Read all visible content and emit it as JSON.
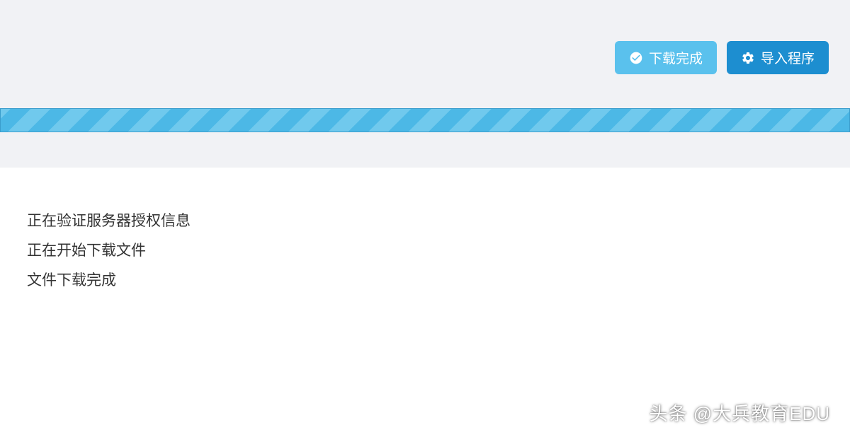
{
  "toolbar": {
    "download_complete_label": "下载完成",
    "import_program_label": "导入程序"
  },
  "log": {
    "line1": "正在验证服务器授权信息",
    "line2": "正在开始下载文件",
    "line3": "文件下载完成"
  },
  "watermark": "头条 @大兵教育EDU"
}
